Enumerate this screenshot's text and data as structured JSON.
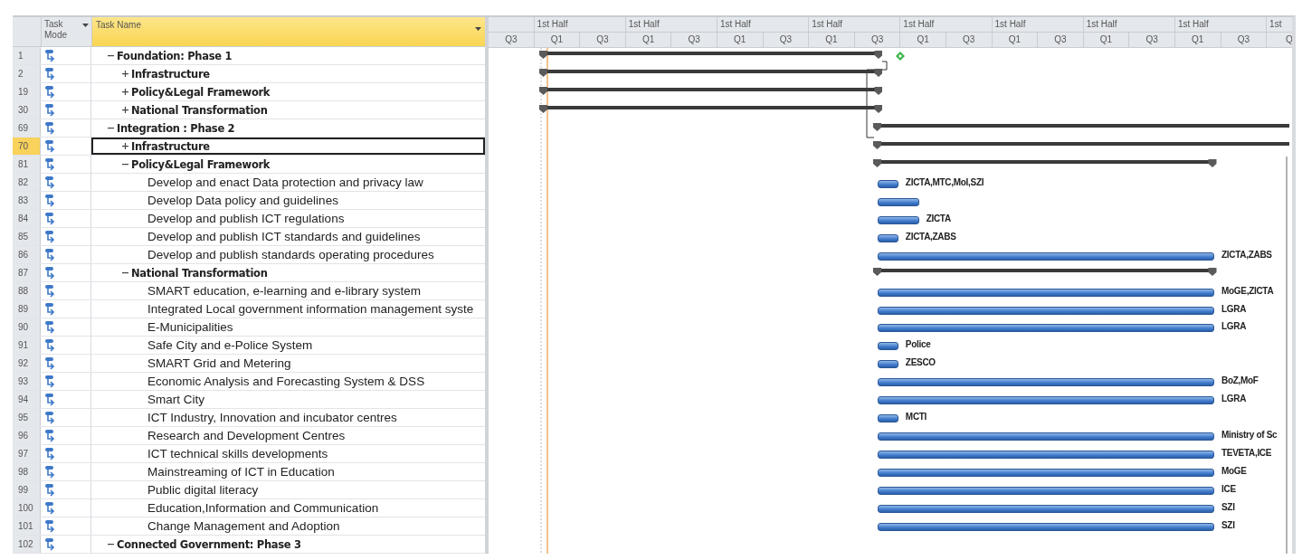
{
  "table": {
    "columns": [
      {
        "label": "Task Mode"
      },
      {
        "label": "Task Name"
      }
    ],
    "rows": [
      {
        "id": "1",
        "name": "Foundation: Phase 1",
        "kind": "summary",
        "expanded": true,
        "selected": false,
        "bar": {
          "kind": "early",
          "milestone": true
        },
        "children": [
          {
            "id": "2",
            "name": "Infrastructure",
            "kind": "summary",
            "expanded": false,
            "selected": false,
            "bar": {
              "kind": "early"
            }
          },
          {
            "id": "19",
            "name": "Policy&Legal Framework",
            "kind": "summary",
            "expanded": false,
            "selected": false,
            "bar": {
              "kind": "early"
            }
          },
          {
            "id": "30",
            "name": "National Transformation",
            "kind": "summary",
            "expanded": false,
            "selected": false,
            "bar": {
              "kind": "early"
            }
          }
        ]
      },
      {
        "id": "69",
        "name": "Integration : Phase 2",
        "kind": "summary",
        "expanded": true,
        "selected": false,
        "bar": {
          "kind": "open"
        },
        "children": [
          {
            "id": "70",
            "name": "Infrastructure",
            "kind": "summary",
            "expanded": false,
            "selected": true,
            "bar": {
              "kind": "open"
            }
          },
          {
            "id": "81",
            "name": "Policy&Legal Framework",
            "kind": "summary",
            "expanded": true,
            "selected": false,
            "bar": {
              "kind": "mid"
            },
            "children": [
              {
                "id": "82",
                "name": "Develop and enact Data protection and privacy law",
                "kind": "task",
                "selected": false,
                "bar": {
                  "kind": "short",
                  "label": "ZICTA,MTC,MoI,SZI"
                }
              },
              {
                "id": "83",
                "name": "Develop Data policy and guidelines",
                "kind": "task",
                "selected": false,
                "bar": {
                  "kind": "medium"
                }
              },
              {
                "id": "84",
                "name": "Develop and publish ICT regulations",
                "kind": "task",
                "selected": false,
                "bar": {
                  "kind": "medium",
                  "label": "ZICTA"
                }
              },
              {
                "id": "85",
                "name": "Develop and publish ICT standards and guidelines",
                "kind": "task",
                "selected": false,
                "bar": {
                  "kind": "short",
                  "label": "ZICTA,ZABS"
                }
              },
              {
                "id": "86",
                "name": "Develop and publish standards operating procedures",
                "kind": "task",
                "selected": false,
                "bar": {
                  "kind": "long",
                  "label": "ZICTA,ZABS"
                }
              }
            ]
          },
          {
            "id": "87",
            "name": "National Transformation",
            "kind": "summary",
            "expanded": true,
            "selected": false,
            "bar": {
              "kind": "mid"
            },
            "children": [
              {
                "id": "88",
                "name": "SMART education, e-learning and e-library system",
                "kind": "task",
                "selected": false,
                "bar": {
                  "kind": "long",
                  "label": "MoGE,ZICTA"
                }
              },
              {
                "id": "89",
                "name": "Integrated Local government information management syste",
                "kind": "task",
                "selected": false,
                "bar": {
                  "kind": "long",
                  "label": "LGRA"
                }
              },
              {
                "id": "90",
                "name": "E-Municipalities",
                "kind": "task",
                "selected": false,
                "bar": {
                  "kind": "long",
                  "label": "LGRA"
                }
              },
              {
                "id": "91",
                "name": "Safe City and e-Police System",
                "kind": "task",
                "selected": false,
                "bar": {
                  "kind": "short",
                  "label": "Police"
                }
              },
              {
                "id": "92",
                "name": "SMART Grid and Metering",
                "kind": "task",
                "selected": false,
                "bar": {
                  "kind": "short",
                  "label": "ZESCO"
                }
              },
              {
                "id": "93",
                "name": "Economic Analysis and Forecasting System & DSS",
                "kind": "task",
                "selected": false,
                "bar": {
                  "kind": "long",
                  "label": "BoZ,MoF"
                }
              },
              {
                "id": "94",
                "name": "Smart City",
                "kind": "task",
                "selected": false,
                "bar": {
                  "kind": "long",
                  "label": "LGRA"
                }
              },
              {
                "id": "95",
                "name": "ICT Industry, Innovation and incubator centres",
                "kind": "task",
                "selected": false,
                "bar": {
                  "kind": "short",
                  "label": "MCTI"
                }
              },
              {
                "id": "96",
                "name": "Research and Development Centres",
                "kind": "task",
                "selected": false,
                "bar": {
                  "kind": "long",
                  "label": "Ministry of Sc"
                }
              },
              {
                "id": "97",
                "name": "ICT technical skills developments",
                "kind": "task",
                "selected": false,
                "bar": {
                  "kind": "long",
                  "label": "TEVETA,ICE"
                }
              },
              {
                "id": "98",
                "name": "Mainstreaming of ICT in Education",
                "kind": "task",
                "selected": false,
                "bar": {
                  "kind": "long",
                  "label": "MoGE"
                }
              },
              {
                "id": "99",
                "name": "Public digital literacy",
                "kind": "task",
                "selected": false,
                "bar": {
                  "kind": "long",
                  "label": "ICE"
                }
              },
              {
                "id": "100",
                "name": "Education,Information and Communication",
                "kind": "task",
                "selected": false,
                "bar": {
                  "kind": "long",
                  "label": "SZI"
                }
              },
              {
                "id": "101",
                "name": "Change Management and Adoption",
                "kind": "task",
                "selected": false,
                "bar": {
                  "kind": "long",
                  "label": "SZI"
                }
              }
            ]
          }
        ]
      },
      {
        "id": "102",
        "name": "Connected Government: Phase 3",
        "kind": "summary",
        "expanded": true,
        "selected": false
      }
    ]
  },
  "timescale": {
    "top": [
      "1st Half",
      "1st Half",
      "1st Half",
      "1st Half",
      "1st Half",
      "1st Half",
      "1st Half",
      "1st Half",
      "1st"
    ],
    "bottom": [
      "Q3",
      "Q1",
      "Q3",
      "Q1",
      "Q3",
      "Q1",
      "Q3",
      "Q1",
      "Q3",
      "Q1",
      "Q3",
      "Q1",
      "Q3",
      "Q1",
      "Q3",
      "Q1",
      "Q3",
      "Q"
    ]
  }
}
